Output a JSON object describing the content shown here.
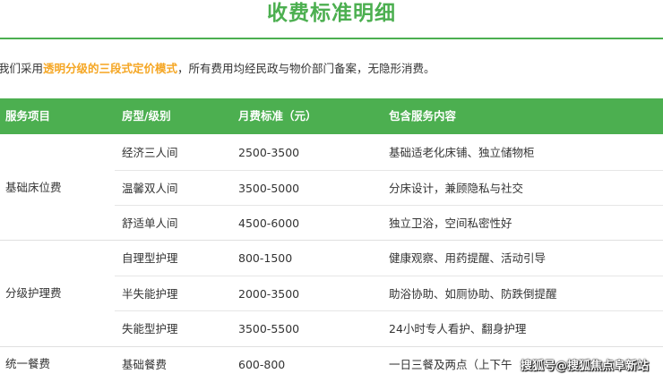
{
  "title": "收费标准明细",
  "intro": {
    "prefix": "我们采用",
    "highlight": "透明分级的三段式定价模式",
    "suffix": "，所有费用均经民政与物价部门备案，无隐形消费。"
  },
  "table": {
    "headers": [
      "服务项目",
      "房型/级别",
      "月费标准（元）",
      "包含服务内容"
    ],
    "groups": [
      {
        "name": "基础床位费",
        "rows": [
          {
            "level": "经济三人间",
            "price": "2500-3500",
            "content": "基础适老化床铺、独立储物柜"
          },
          {
            "level": "温馨双人间",
            "price": "3500-5000",
            "content": "分床设计，兼顾隐私与社交"
          },
          {
            "level": "舒适单人间",
            "price": "4500-6000",
            "content": "独立卫浴，空间私密性好"
          }
        ]
      },
      {
        "name": "分级护理费",
        "rows": [
          {
            "level": "自理型护理",
            "price": "800-1500",
            "content": "健康观察、用药提醒、活动引导"
          },
          {
            "level": "半失能护理",
            "price": "2000-3500",
            "content": "助浴协助、如厕协助、防跌倒提醒"
          },
          {
            "level": "失能型护理",
            "price": "3500-5500",
            "content": "24小时专人看护、翻身护理"
          }
        ]
      },
      {
        "name": "统一餐费",
        "rows": [
          {
            "level": "基础餐费",
            "price": "600-800",
            "content": "一日三餐及两点（上下午"
          }
        ]
      }
    ]
  },
  "watermark": "搜狐号@搜狐焦点阜新站",
  "colors": {
    "accent": "#4caf50",
    "highlight": "#f5a623"
  }
}
